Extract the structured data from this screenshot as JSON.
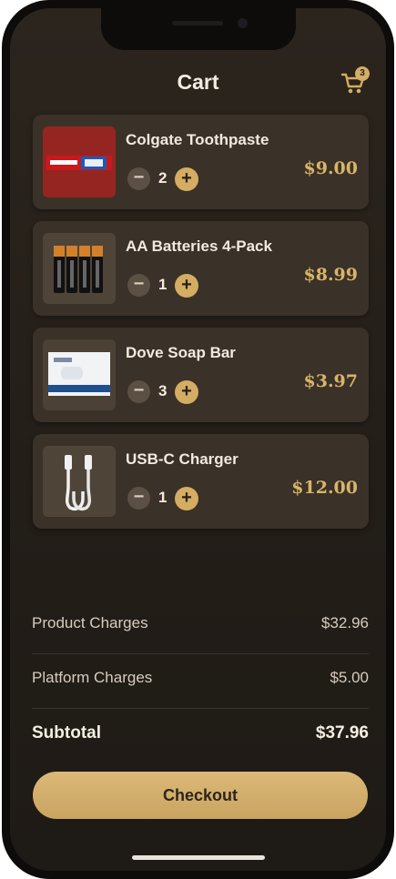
{
  "header": {
    "title": "Cart",
    "cart_count": "3"
  },
  "items": [
    {
      "name": "Colgate Toothpaste",
      "qty": "2",
      "price": "$9.00",
      "image": "toothpaste-image"
    },
    {
      "name": "AA Batteries 4-Pack",
      "qty": "1",
      "price": "$8.99",
      "image": "batteries-image"
    },
    {
      "name": "Dove Soap Bar",
      "qty": "3",
      "price": "$3.97",
      "image": "soap-image"
    },
    {
      "name": "USB-C Charger",
      "qty": "1",
      "price": "$12.00",
      "image": "charger-image"
    }
  ],
  "controls": {
    "minus": "−",
    "plus": "+"
  },
  "summary": {
    "product_label": "Product Charges",
    "product_value": "$32.96",
    "platform_label": "Platform Charges",
    "platform_value": "$5.00",
    "subtotal_label": "Subtotal",
    "subtotal_value": "$37.96"
  },
  "checkout_label": "Checkout",
  "colors": {
    "accent": "#d4ad63",
    "background": "#2c251e",
    "card": "#3a3128",
    "price": "#d8b46a"
  }
}
